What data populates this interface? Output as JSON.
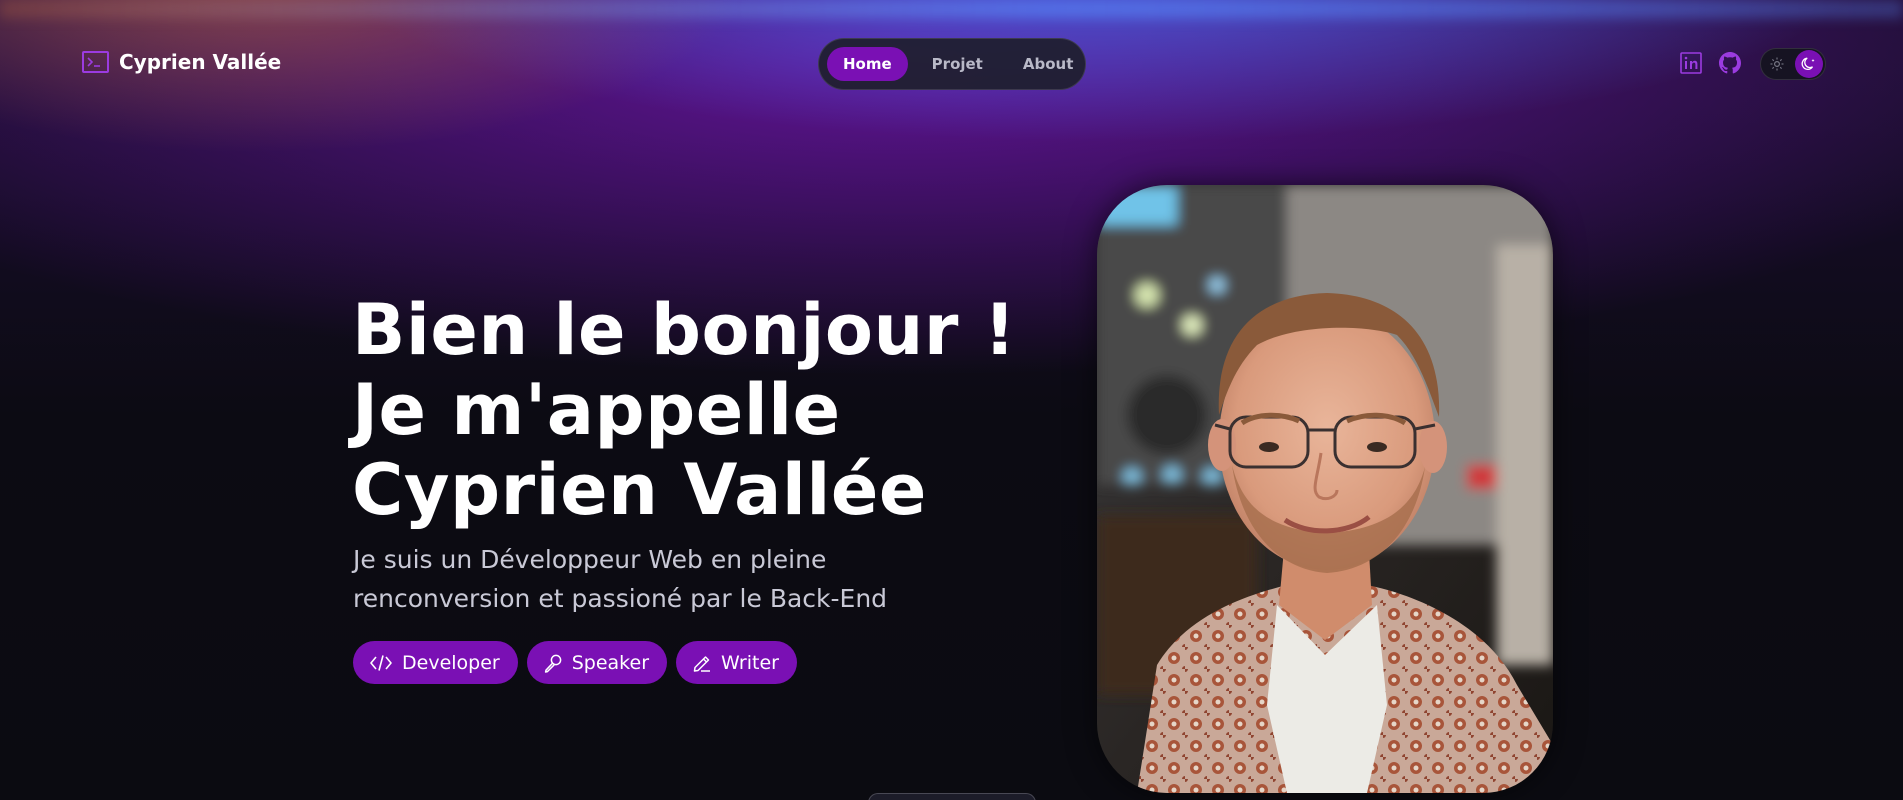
{
  "brand": {
    "title": "Cyprien Vallée",
    "icon": "terminal-icon"
  },
  "nav": {
    "items": [
      {
        "label": "Home",
        "active": true
      },
      {
        "label": "Projet",
        "active": false
      },
      {
        "label": "About",
        "active": false
      }
    ]
  },
  "social": {
    "linkedin_icon": "linkedin-icon",
    "github_icon": "github-icon"
  },
  "theme_toggle": {
    "sun_icon": "sun-icon",
    "moon_icon": "moon-icon",
    "mode": "dark"
  },
  "hero": {
    "title": "Bien le bonjour ! Je m'appelle Cyprien Vallée",
    "subtitle": "Je suis un Développeur Web en pleine renconversion et passioné par le Back-End",
    "tags": [
      {
        "label": "Developer",
        "icon": "code-icon"
      },
      {
        "label": "Speaker",
        "icon": "microphone-icon"
      },
      {
        "label": "Writer",
        "icon": "pencil-icon"
      }
    ]
  },
  "colors": {
    "accent": "#7a10b4",
    "accent_light": "#9b3be0",
    "background": "#0b0b12",
    "text_muted": "#c9c9d6"
  }
}
